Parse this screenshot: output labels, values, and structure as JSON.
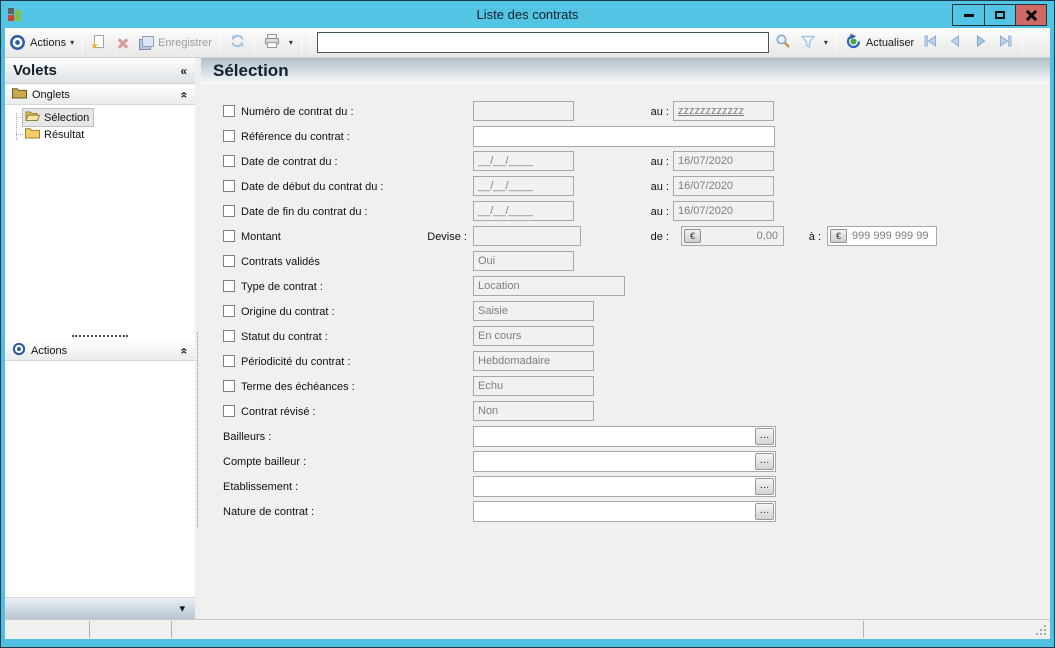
{
  "window": {
    "title": "Liste des contrats"
  },
  "toolbar": {
    "actions_label": "Actions",
    "save_label": "Enregistrer",
    "refresh_label": "Actualiser",
    "search_value": ""
  },
  "sidebar": {
    "title": "Volets",
    "onglets_label": "Onglets",
    "actions_label": "Actions",
    "tree": {
      "selection_label": "Sélection",
      "resultat_label": "Résultat"
    }
  },
  "main": {
    "title": "Sélection"
  },
  "form": {
    "numero": {
      "label": "Numéro de contrat du :",
      "from_value": "",
      "to_label": "au :",
      "to_value": "zzzzzzzzzzzz"
    },
    "reference": {
      "label": "Référence du contrat :",
      "value": ""
    },
    "date_contrat": {
      "label": "Date de contrat du :",
      "from_value": "__/__/____",
      "to_label": "au :",
      "to_value": "16/07/2020"
    },
    "date_debut": {
      "label": "Date de début du contrat du :",
      "from_value": "__/__/____",
      "to_label": "au :",
      "to_value": "16/07/2020"
    },
    "date_fin": {
      "label": "Date de fin du contrat du :",
      "from_value": "__/__/____",
      "to_label": "au :",
      "to_value": "16/07/2020"
    },
    "montant": {
      "label": "Montant",
      "devise_label": "Devise :",
      "devise_value": "",
      "de_label": "de :",
      "de_value": "0,00",
      "a_label": "à :",
      "a_value": "999 999 999 99"
    },
    "valides": {
      "label": "Contrats validés",
      "value": "Oui"
    },
    "type_contrat": {
      "label": "Type de contrat :",
      "value": "Location"
    },
    "origine": {
      "label": "Origine du contrat :",
      "value": "Saisie"
    },
    "statut": {
      "label": "Statut du contrat :",
      "value": "En cours"
    },
    "periodicite": {
      "label": "Périodicité du contrat :",
      "value": "Hebdomadaire"
    },
    "terme": {
      "label": "Terme des échéances :",
      "value": "Echu"
    },
    "revise": {
      "label": "Contrat révisé :",
      "value": "Non"
    },
    "bailleurs": {
      "label": "Bailleurs :",
      "value": ""
    },
    "compte_bailleur": {
      "label": "Compte bailleur :",
      "value": ""
    },
    "etablissement": {
      "label": "Etablissement :",
      "value": ""
    },
    "nature": {
      "label": "Nature de contrat :",
      "value": ""
    }
  },
  "icons": {
    "caret_down": "▾",
    "collapse_left": "«",
    "collapse_up": "«",
    "ellipsis": "…",
    "euro": "€",
    "star": "★"
  },
  "colors": {
    "titlebar_blue": "#54c4e4",
    "close_button_red": "#cd6a63",
    "accent_blue": "#2c5aa0",
    "header_gradient_top": "#b2c0ca"
  }
}
